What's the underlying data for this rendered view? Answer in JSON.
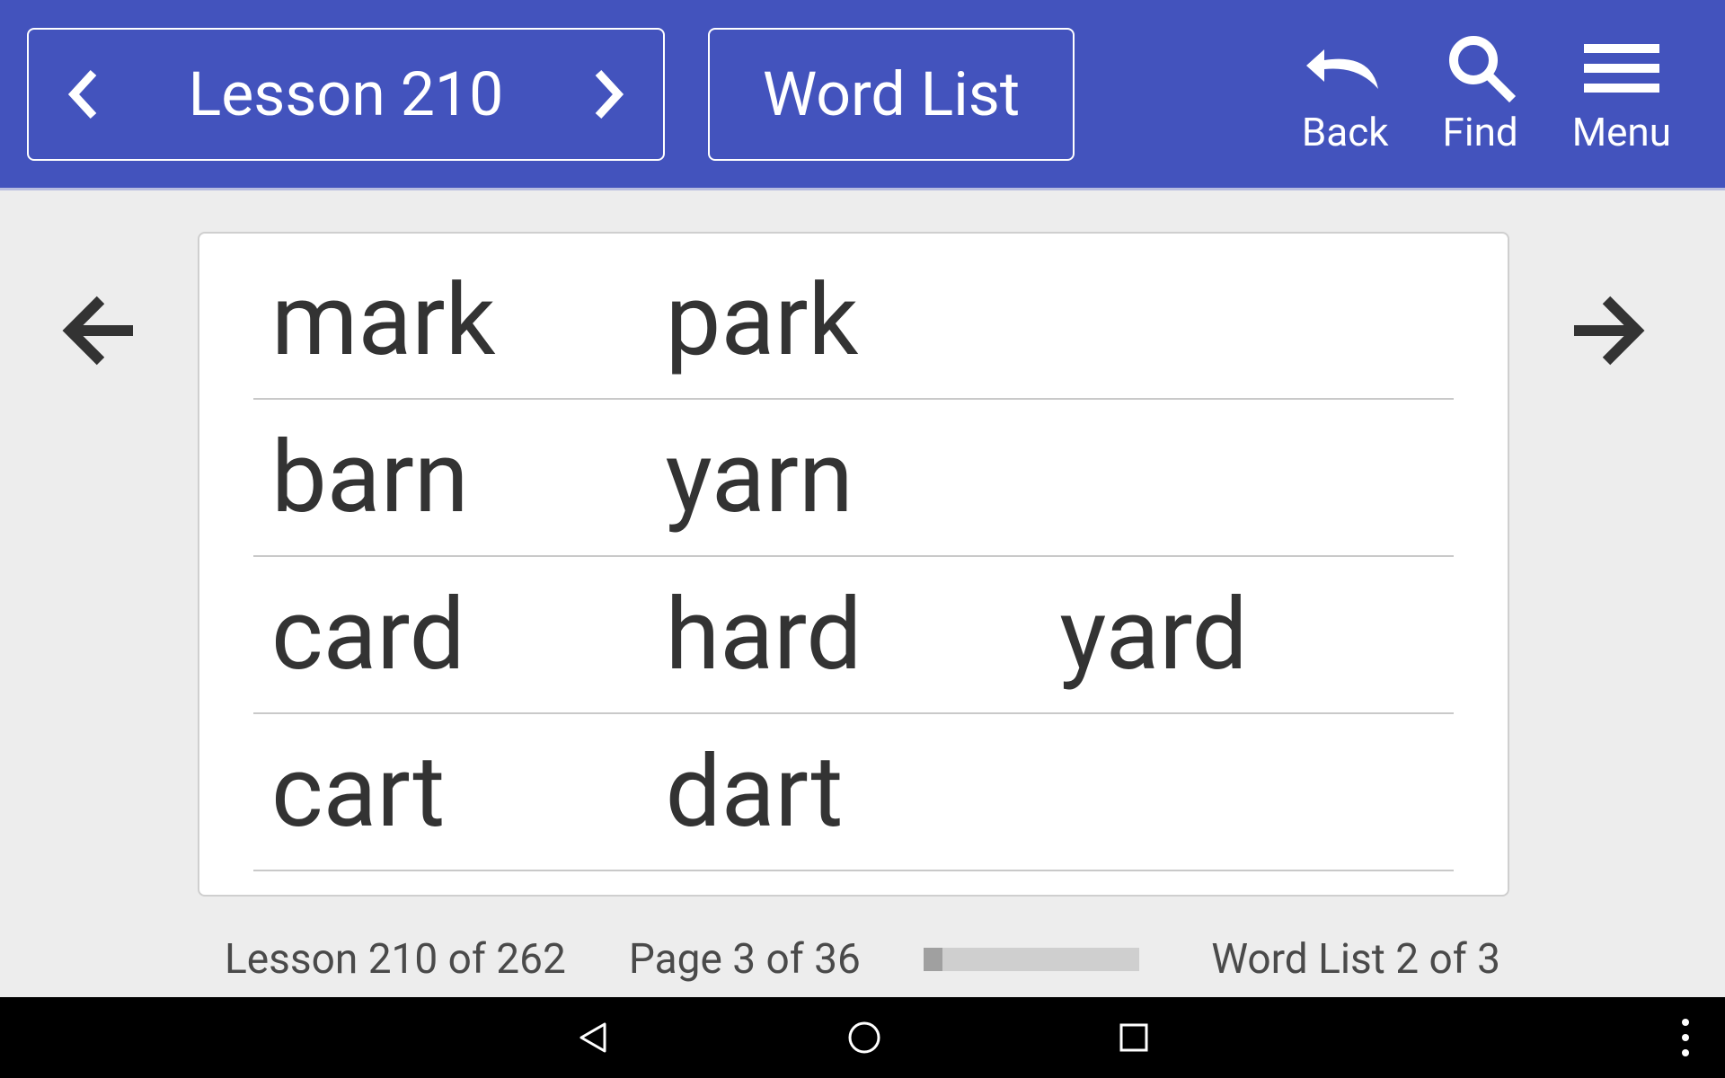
{
  "toolbar": {
    "lesson_title": "Lesson 210",
    "wordlist_label": "Word List",
    "back_label": "Back",
    "find_label": "Find",
    "menu_label": "Menu"
  },
  "words": {
    "rows": [
      [
        "mark",
        "park",
        ""
      ],
      [
        "barn",
        "yarn",
        ""
      ],
      [
        "card",
        "hard",
        "yard"
      ],
      [
        "cart",
        "dart",
        ""
      ]
    ]
  },
  "status": {
    "lesson": "Lesson 210 of 262",
    "page": "Page 3 of 36",
    "wordlist": "Word List 2 of 3"
  }
}
